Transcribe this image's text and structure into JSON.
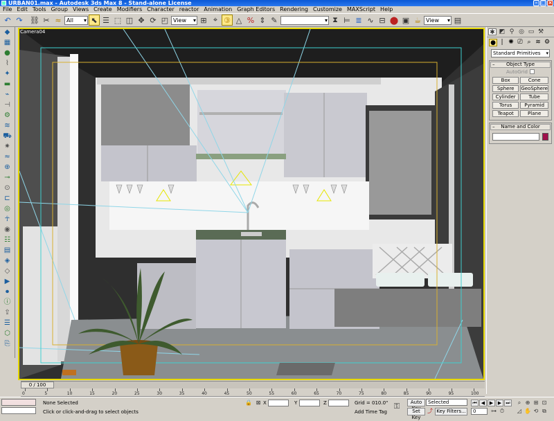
{
  "window": {
    "title": "URBAN01.max - Autodesk 3ds Max 8  - Stand-alone License"
  },
  "menu": [
    "File",
    "Edit",
    "Tools",
    "Group",
    "Views",
    "Create",
    "Modifiers",
    "Character",
    "reactor",
    "Animation",
    "Graph Editors",
    "Rendering",
    "Customize",
    "MAXScript",
    "Help"
  ],
  "toolbar": {
    "selection_filter": "All",
    "ref_coord": "View",
    "named_selection": "",
    "render_view": "View"
  },
  "viewport": {
    "label": "Camera04"
  },
  "command_panel": {
    "category": "Standard Primitives",
    "object_type_title": "Object Type",
    "autogrid_label": "AutoGrid",
    "objects": [
      "Box",
      "Cone",
      "Sphere",
      "GeoSphere",
      "Cylinder",
      "Tube",
      "Torus",
      "Pyramid",
      "Teapot",
      "Plane"
    ],
    "name_color_title": "Name and Color",
    "name_value": "",
    "object_color": "#a0104a"
  },
  "timeline": {
    "slider_label": "0 / 100",
    "ticks": [
      "0",
      "5",
      "10",
      "15",
      "20",
      "25",
      "30",
      "35",
      "40",
      "45",
      "50",
      "55",
      "60",
      "65",
      "70",
      "75",
      "80",
      "85",
      "90",
      "95",
      "100"
    ]
  },
  "status": {
    "selection": "None Selected",
    "prompt": "Click or click-and-drag to select objects",
    "x_label": "X",
    "y_label": "Y",
    "z_label": "Z",
    "x_value": "",
    "y_value": "",
    "z_value": "",
    "grid": "Grid = 010.0\"",
    "add_time_tag": "Add Time Tag",
    "auto_key": "Auto Key",
    "set_key": "Set Key",
    "key_mode": "Selected",
    "key_filters": "Key Filters...",
    "frame": "0"
  }
}
